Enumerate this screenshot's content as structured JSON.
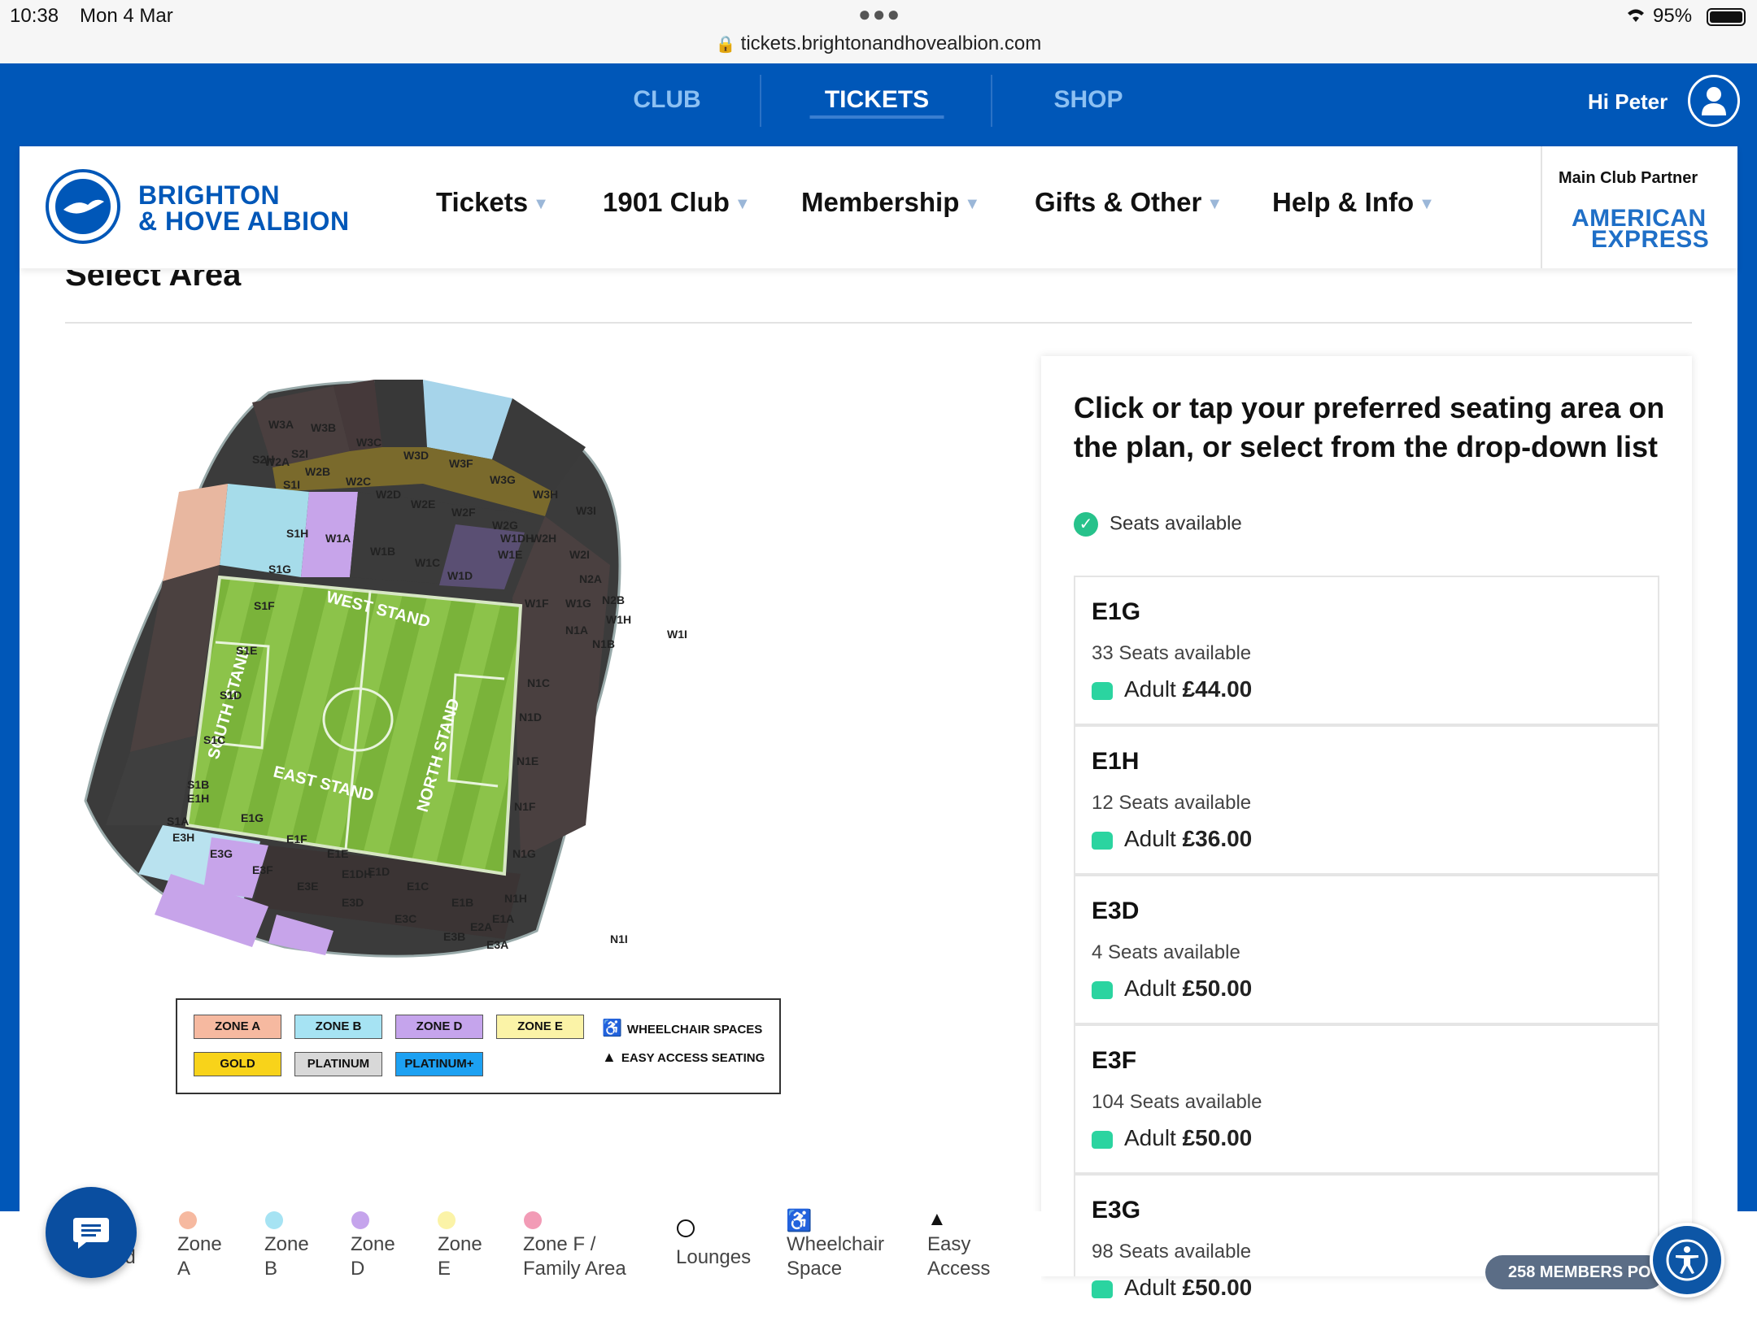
{
  "status_bar": {
    "time": "10:38",
    "date": "Mon 4 Mar",
    "url": "tickets.brightonandhovealbion.com",
    "battery": "95%"
  },
  "top_nav": {
    "tabs": [
      "CLUB",
      "TICKETS",
      "SHOP"
    ],
    "active": "TICKETS",
    "greeting": "Hi Peter"
  },
  "brand": {
    "line1": "BRIGHTON",
    "line2": "& HOVE ALBION",
    "color": "#0057b8"
  },
  "main_menu": [
    "Tickets",
    "1901 Club",
    "Membership",
    "Gifts & Other",
    "Help & Info"
  ],
  "partner": {
    "label": "Main Club Partner",
    "line1": "AMERICAN",
    "line2": "EXPRESS"
  },
  "page": {
    "section_title": "Select Area"
  },
  "stadium": {
    "stands": [
      "WEST STAND",
      "EAST STAND",
      "SOUTH STAND",
      "NORTH STAND"
    ],
    "sections": {
      "west_upper": [
        "W3A",
        "W3B",
        "W3C",
        "W3D",
        "W3F",
        "W3G",
        "W3H",
        "W3I"
      ],
      "west_mid": [
        "W2A",
        "W2B",
        "W2C",
        "W2D",
        "W2E",
        "W2F",
        "W2G",
        "W2H",
        "W2I"
      ],
      "west_lower": [
        "W1A",
        "W1B",
        "W1C",
        "W1D",
        "W1DH",
        "W1E",
        "W1F",
        "W1G",
        "W1H",
        "W1I"
      ],
      "south": [
        "S2H",
        "S2I",
        "S1I",
        "S1H",
        "S1G",
        "S1F",
        "S1E",
        "S1D",
        "S1C",
        "S1B",
        "S1A"
      ],
      "north": [
        "N2A",
        "N2B",
        "N1A",
        "N1B",
        "N1C",
        "N1D",
        "N1E",
        "N1F",
        "N1G",
        "N1H",
        "N1I"
      ],
      "east": [
        "E1H",
        "E1G",
        "E1F",
        "E1E",
        "E1DH",
        "E1D",
        "E1C",
        "E1B",
        "E1A",
        "E3H",
        "E3G",
        "E3F",
        "E3E",
        "E3D",
        "E3C",
        "E3B",
        "E3A",
        "E2A"
      ]
    }
  },
  "map_legend": {
    "chips": [
      {
        "label": "ZONE A",
        "color": "#f6b9a0"
      },
      {
        "label": "ZONE B",
        "color": "#a6e3f3"
      },
      {
        "label": "ZONE D",
        "color": "#c5a4ec"
      },
      {
        "label": "ZONE E",
        "color": "#fbf3a7"
      },
      {
        "label": "GOLD",
        "color": "#f8d31a"
      },
      {
        "label": "PLATINUM",
        "color": "#d8d8d8"
      },
      {
        "label": "PLATINUM+",
        "color": "#1da1f2"
      }
    ],
    "wheelchair": "WHEELCHAIR SPACES",
    "easy_access": "EASY ACCESS SEATING"
  },
  "panel": {
    "heading": "Click or tap your preferred seating area on the plan, or select from the drop-down list",
    "availability": "Seats available",
    "price_prefix": "Adult",
    "areas": [
      {
        "code": "E1G",
        "seats": "33 Seats available",
        "price": "£44.00"
      },
      {
        "code": "E1H",
        "seats": "12 Seats available",
        "price": "£36.00"
      },
      {
        "code": "E3D",
        "seats": "4 Seats available",
        "price": "£50.00"
      },
      {
        "code": "E3F",
        "seats": "104 Seats available",
        "price": "£50.00"
      },
      {
        "code": "E3G",
        "seats": "98 Seats available",
        "price": "£50.00"
      }
    ]
  },
  "bottom_legend": [
    {
      "label": "ed",
      "color": ""
    },
    {
      "label": "Zone A",
      "color": "#f6b9a0"
    },
    {
      "label": "Zone B",
      "color": "#a6e3f3"
    },
    {
      "label": "Zone D",
      "color": "#c5a4ec"
    },
    {
      "label": "Zone E",
      "color": "#fbf3a7"
    },
    {
      "label": "Zone F / Family Area",
      "color": "#f29bb6"
    },
    {
      "label": "Lounges",
      "color": ""
    },
    {
      "label": "Wheelchair Space",
      "color": ""
    },
    {
      "label": "Easy Access",
      "color": ""
    }
  ],
  "members_badge": "258 MEMBERS PO"
}
